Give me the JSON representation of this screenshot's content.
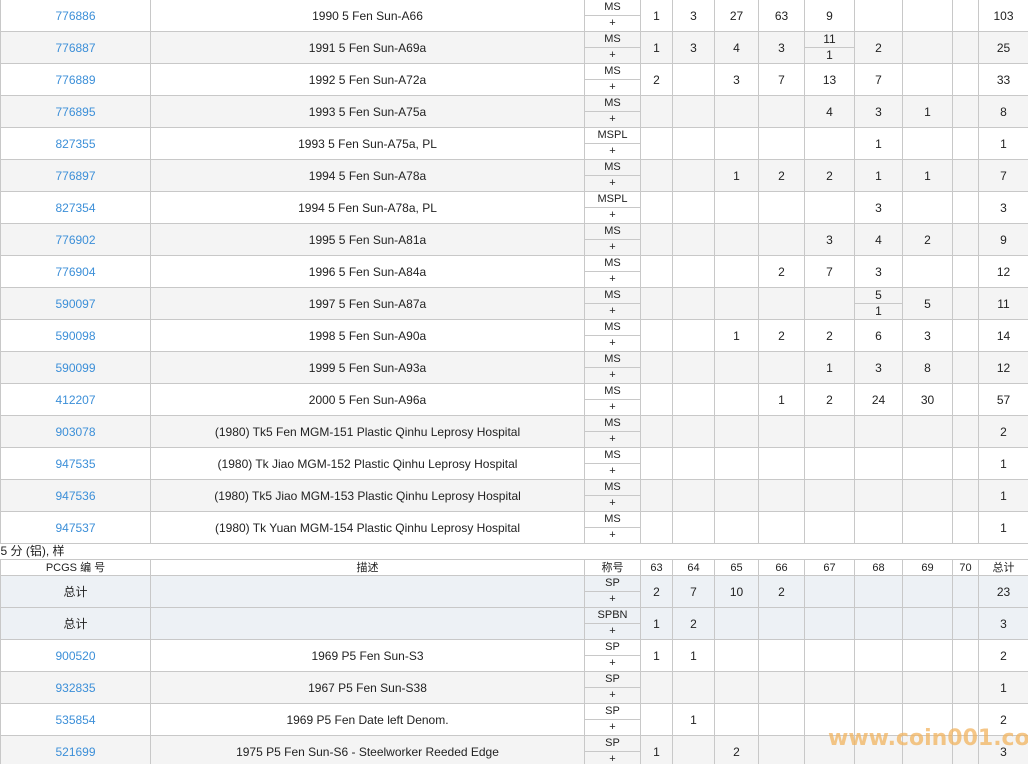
{
  "section_title": "5 分 (铝), 样",
  "header": {
    "pcgs": "PCGS 编 号",
    "desc": "描述",
    "designation": "称号",
    "grades": [
      "63",
      "64",
      "65",
      "66",
      "67",
      "68",
      "69",
      "70"
    ],
    "total": "总计"
  },
  "upper_rows": [
    {
      "pcgs": "776886",
      "desc": "1990 5 Fen Sun-A66",
      "des": "MS",
      "plus": "+",
      "g": [
        [
          "1"
        ],
        [
          "3"
        ],
        [
          "27"
        ],
        [
          "63"
        ],
        [
          "9"
        ],
        [
          ""
        ],
        [
          ""
        ],
        [
          ""
        ]
      ],
      "total": "103"
    },
    {
      "pcgs": "776887",
      "desc": "1991 5 Fen Sun-A69a",
      "des": "MS",
      "plus": "+",
      "g": [
        [
          "1"
        ],
        [
          "3"
        ],
        [
          "4"
        ],
        [
          "3"
        ],
        [
          "11",
          "1"
        ],
        [
          "2"
        ],
        [
          ""
        ],
        [
          ""
        ]
      ],
      "total": "25"
    },
    {
      "pcgs": "776889",
      "desc": "1992 5 Fen Sun-A72a",
      "des": "MS",
      "plus": "+",
      "g": [
        [
          "2"
        ],
        [
          ""
        ],
        [
          "3"
        ],
        [
          "7"
        ],
        [
          "13"
        ],
        [
          "7"
        ],
        [
          ""
        ],
        [
          ""
        ]
      ],
      "total": "33"
    },
    {
      "pcgs": "776895",
      "desc": "1993 5 Fen Sun-A75a",
      "des": "MS",
      "plus": "+",
      "g": [
        [
          ""
        ],
        [
          ""
        ],
        [
          ""
        ],
        [
          ""
        ],
        [
          "4"
        ],
        [
          "3"
        ],
        [
          "1"
        ],
        [
          ""
        ]
      ],
      "total": "8"
    },
    {
      "pcgs": "827355",
      "desc": "1993 5 Fen Sun-A75a, PL",
      "des": "MSPL",
      "plus": "+",
      "g": [
        [
          ""
        ],
        [
          ""
        ],
        [
          ""
        ],
        [
          ""
        ],
        [
          ""
        ],
        [
          "1"
        ],
        [
          ""
        ],
        [
          ""
        ]
      ],
      "total": "1"
    },
    {
      "pcgs": "776897",
      "desc": "1994 5 Fen Sun-A78a",
      "des": "MS",
      "plus": "+",
      "g": [
        [
          ""
        ],
        [
          ""
        ],
        [
          "1"
        ],
        [
          "2"
        ],
        [
          "2"
        ],
        [
          "1"
        ],
        [
          "1"
        ],
        [
          ""
        ]
      ],
      "total": "7"
    },
    {
      "pcgs": "827354",
      "desc": "1994 5 Fen Sun-A78a, PL",
      "des": "MSPL",
      "plus": "+",
      "g": [
        [
          ""
        ],
        [
          ""
        ],
        [
          ""
        ],
        [
          ""
        ],
        [
          ""
        ],
        [
          "3"
        ],
        [
          ""
        ],
        [
          ""
        ]
      ],
      "total": "3"
    },
    {
      "pcgs": "776902",
      "desc": "1995 5 Fen Sun-A81a",
      "des": "MS",
      "plus": "+",
      "g": [
        [
          ""
        ],
        [
          ""
        ],
        [
          ""
        ],
        [
          ""
        ],
        [
          "3"
        ],
        [
          "4"
        ],
        [
          "2"
        ],
        [
          ""
        ]
      ],
      "total": "9"
    },
    {
      "pcgs": "776904",
      "desc": "1996 5 Fen Sun-A84a",
      "des": "MS",
      "plus": "+",
      "g": [
        [
          ""
        ],
        [
          ""
        ],
        [
          ""
        ],
        [
          "2"
        ],
        [
          "7"
        ],
        [
          "3"
        ],
        [
          ""
        ],
        [
          ""
        ]
      ],
      "total": "12"
    },
    {
      "pcgs": "590097",
      "desc": "1997 5 Fen Sun-A87a",
      "des": "MS",
      "plus": "+",
      "g": [
        [
          ""
        ],
        [
          ""
        ],
        [
          ""
        ],
        [
          ""
        ],
        [
          ""
        ],
        [
          "5",
          "1"
        ],
        [
          "5"
        ],
        [
          ""
        ]
      ],
      "total": "11"
    },
    {
      "pcgs": "590098",
      "desc": "1998 5 Fen Sun-A90a",
      "des": "MS",
      "plus": "+",
      "g": [
        [
          ""
        ],
        [
          ""
        ],
        [
          "1"
        ],
        [
          "2"
        ],
        [
          "2"
        ],
        [
          "6"
        ],
        [
          "3"
        ],
        [
          ""
        ]
      ],
      "total": "14"
    },
    {
      "pcgs": "590099",
      "desc": "1999 5 Fen Sun-A93a",
      "des": "MS",
      "plus": "+",
      "g": [
        [
          ""
        ],
        [
          ""
        ],
        [
          ""
        ],
        [
          ""
        ],
        [
          "1"
        ],
        [
          "3"
        ],
        [
          "8"
        ],
        [
          ""
        ]
      ],
      "total": "12"
    },
    {
      "pcgs": "412207",
      "desc": "2000 5 Fen Sun-A96a",
      "des": "MS",
      "plus": "+",
      "g": [
        [
          ""
        ],
        [
          ""
        ],
        [
          ""
        ],
        [
          "1"
        ],
        [
          "2"
        ],
        [
          "24"
        ],
        [
          "30"
        ],
        [
          ""
        ]
      ],
      "total": "57"
    },
    {
      "pcgs": "903078",
      "desc": "(1980) Tk5 Fen MGM-151 Plastic Qinhu Leprosy Hospital",
      "des": "MS",
      "plus": "+",
      "g": [
        [
          ""
        ],
        [
          ""
        ],
        [
          ""
        ],
        [
          ""
        ],
        [
          ""
        ],
        [
          ""
        ],
        [
          ""
        ],
        [
          ""
        ]
      ],
      "total": "2"
    },
    {
      "pcgs": "947535",
      "desc": "(1980) Tk Jiao MGM-152 Plastic Qinhu Leprosy Hospital",
      "des": "MS",
      "plus": "+",
      "g": [
        [
          ""
        ],
        [
          ""
        ],
        [
          ""
        ],
        [
          ""
        ],
        [
          ""
        ],
        [
          ""
        ],
        [
          ""
        ],
        [
          ""
        ]
      ],
      "total": "1"
    },
    {
      "pcgs": "947536",
      "desc": "(1980) Tk5 Jiao MGM-153 Plastic Qinhu Leprosy Hospital",
      "des": "MS",
      "plus": "+",
      "g": [
        [
          ""
        ],
        [
          ""
        ],
        [
          ""
        ],
        [
          ""
        ],
        [
          ""
        ],
        [
          ""
        ],
        [
          ""
        ],
        [
          ""
        ]
      ],
      "total": "1"
    },
    {
      "pcgs": "947537",
      "desc": "(1980) Tk Yuan MGM-154 Plastic Qinhu Leprosy Hospital",
      "des": "MS",
      "plus": "+",
      "g": [
        [
          ""
        ],
        [
          ""
        ],
        [
          ""
        ],
        [
          ""
        ],
        [
          ""
        ],
        [
          ""
        ],
        [
          ""
        ],
        [
          ""
        ]
      ],
      "total": "1"
    }
  ],
  "lower_rows": [
    {
      "type": "total",
      "pcgs": "总计",
      "desc": "",
      "des": "SP",
      "plus": "+",
      "g": [
        [
          "2"
        ],
        [
          "7"
        ],
        [
          "10"
        ],
        [
          "2"
        ],
        [
          ""
        ],
        [
          ""
        ],
        [
          ""
        ],
        [
          ""
        ]
      ],
      "total": "23"
    },
    {
      "type": "total",
      "pcgs": "总计",
      "desc": "",
      "des": "SPBN",
      "plus": "+",
      "g": [
        [
          "1"
        ],
        [
          "2"
        ],
        [
          ""
        ],
        [
          ""
        ],
        [
          ""
        ],
        [
          ""
        ],
        [
          ""
        ],
        [
          ""
        ]
      ],
      "total": "3"
    },
    {
      "type": "coin",
      "pcgs": "900520",
      "desc": "1969 P5 Fen Sun-S3",
      "des": "SP",
      "plus": "+",
      "g": [
        [
          "1"
        ],
        [
          "1"
        ],
        [
          ""
        ],
        [
          ""
        ],
        [
          ""
        ],
        [
          ""
        ],
        [
          ""
        ],
        [
          ""
        ]
      ],
      "total": "2"
    },
    {
      "type": "coin",
      "pcgs": "932835",
      "desc": "1967 P5 Fen Sun-S38",
      "des": "SP",
      "plus": "+",
      "g": [
        [
          ""
        ],
        [
          ""
        ],
        [
          ""
        ],
        [
          ""
        ],
        [
          ""
        ],
        [
          ""
        ],
        [
          ""
        ],
        [
          ""
        ]
      ],
      "total": "1"
    },
    {
      "type": "coin",
      "pcgs": "535854",
      "desc": "1969 P5 Fen Date left Denom.",
      "des": "SP",
      "plus": "+",
      "g": [
        [
          ""
        ],
        [
          "1"
        ],
        [
          ""
        ],
        [
          ""
        ],
        [
          ""
        ],
        [
          ""
        ],
        [
          ""
        ],
        [
          ""
        ]
      ],
      "total": "2"
    },
    {
      "type": "coin",
      "pcgs": "521699",
      "desc": "1975 P5 Fen Sun-S6 - Steelworker Reeded Edge",
      "des": "SP",
      "plus": "+",
      "g": [
        [
          "1"
        ],
        [
          ""
        ],
        [
          "2"
        ],
        [
          ""
        ],
        [
          ""
        ],
        [
          ""
        ],
        [
          ""
        ],
        [
          ""
        ]
      ],
      "total": "3"
    }
  ],
  "watermark": "www.coin001.com"
}
